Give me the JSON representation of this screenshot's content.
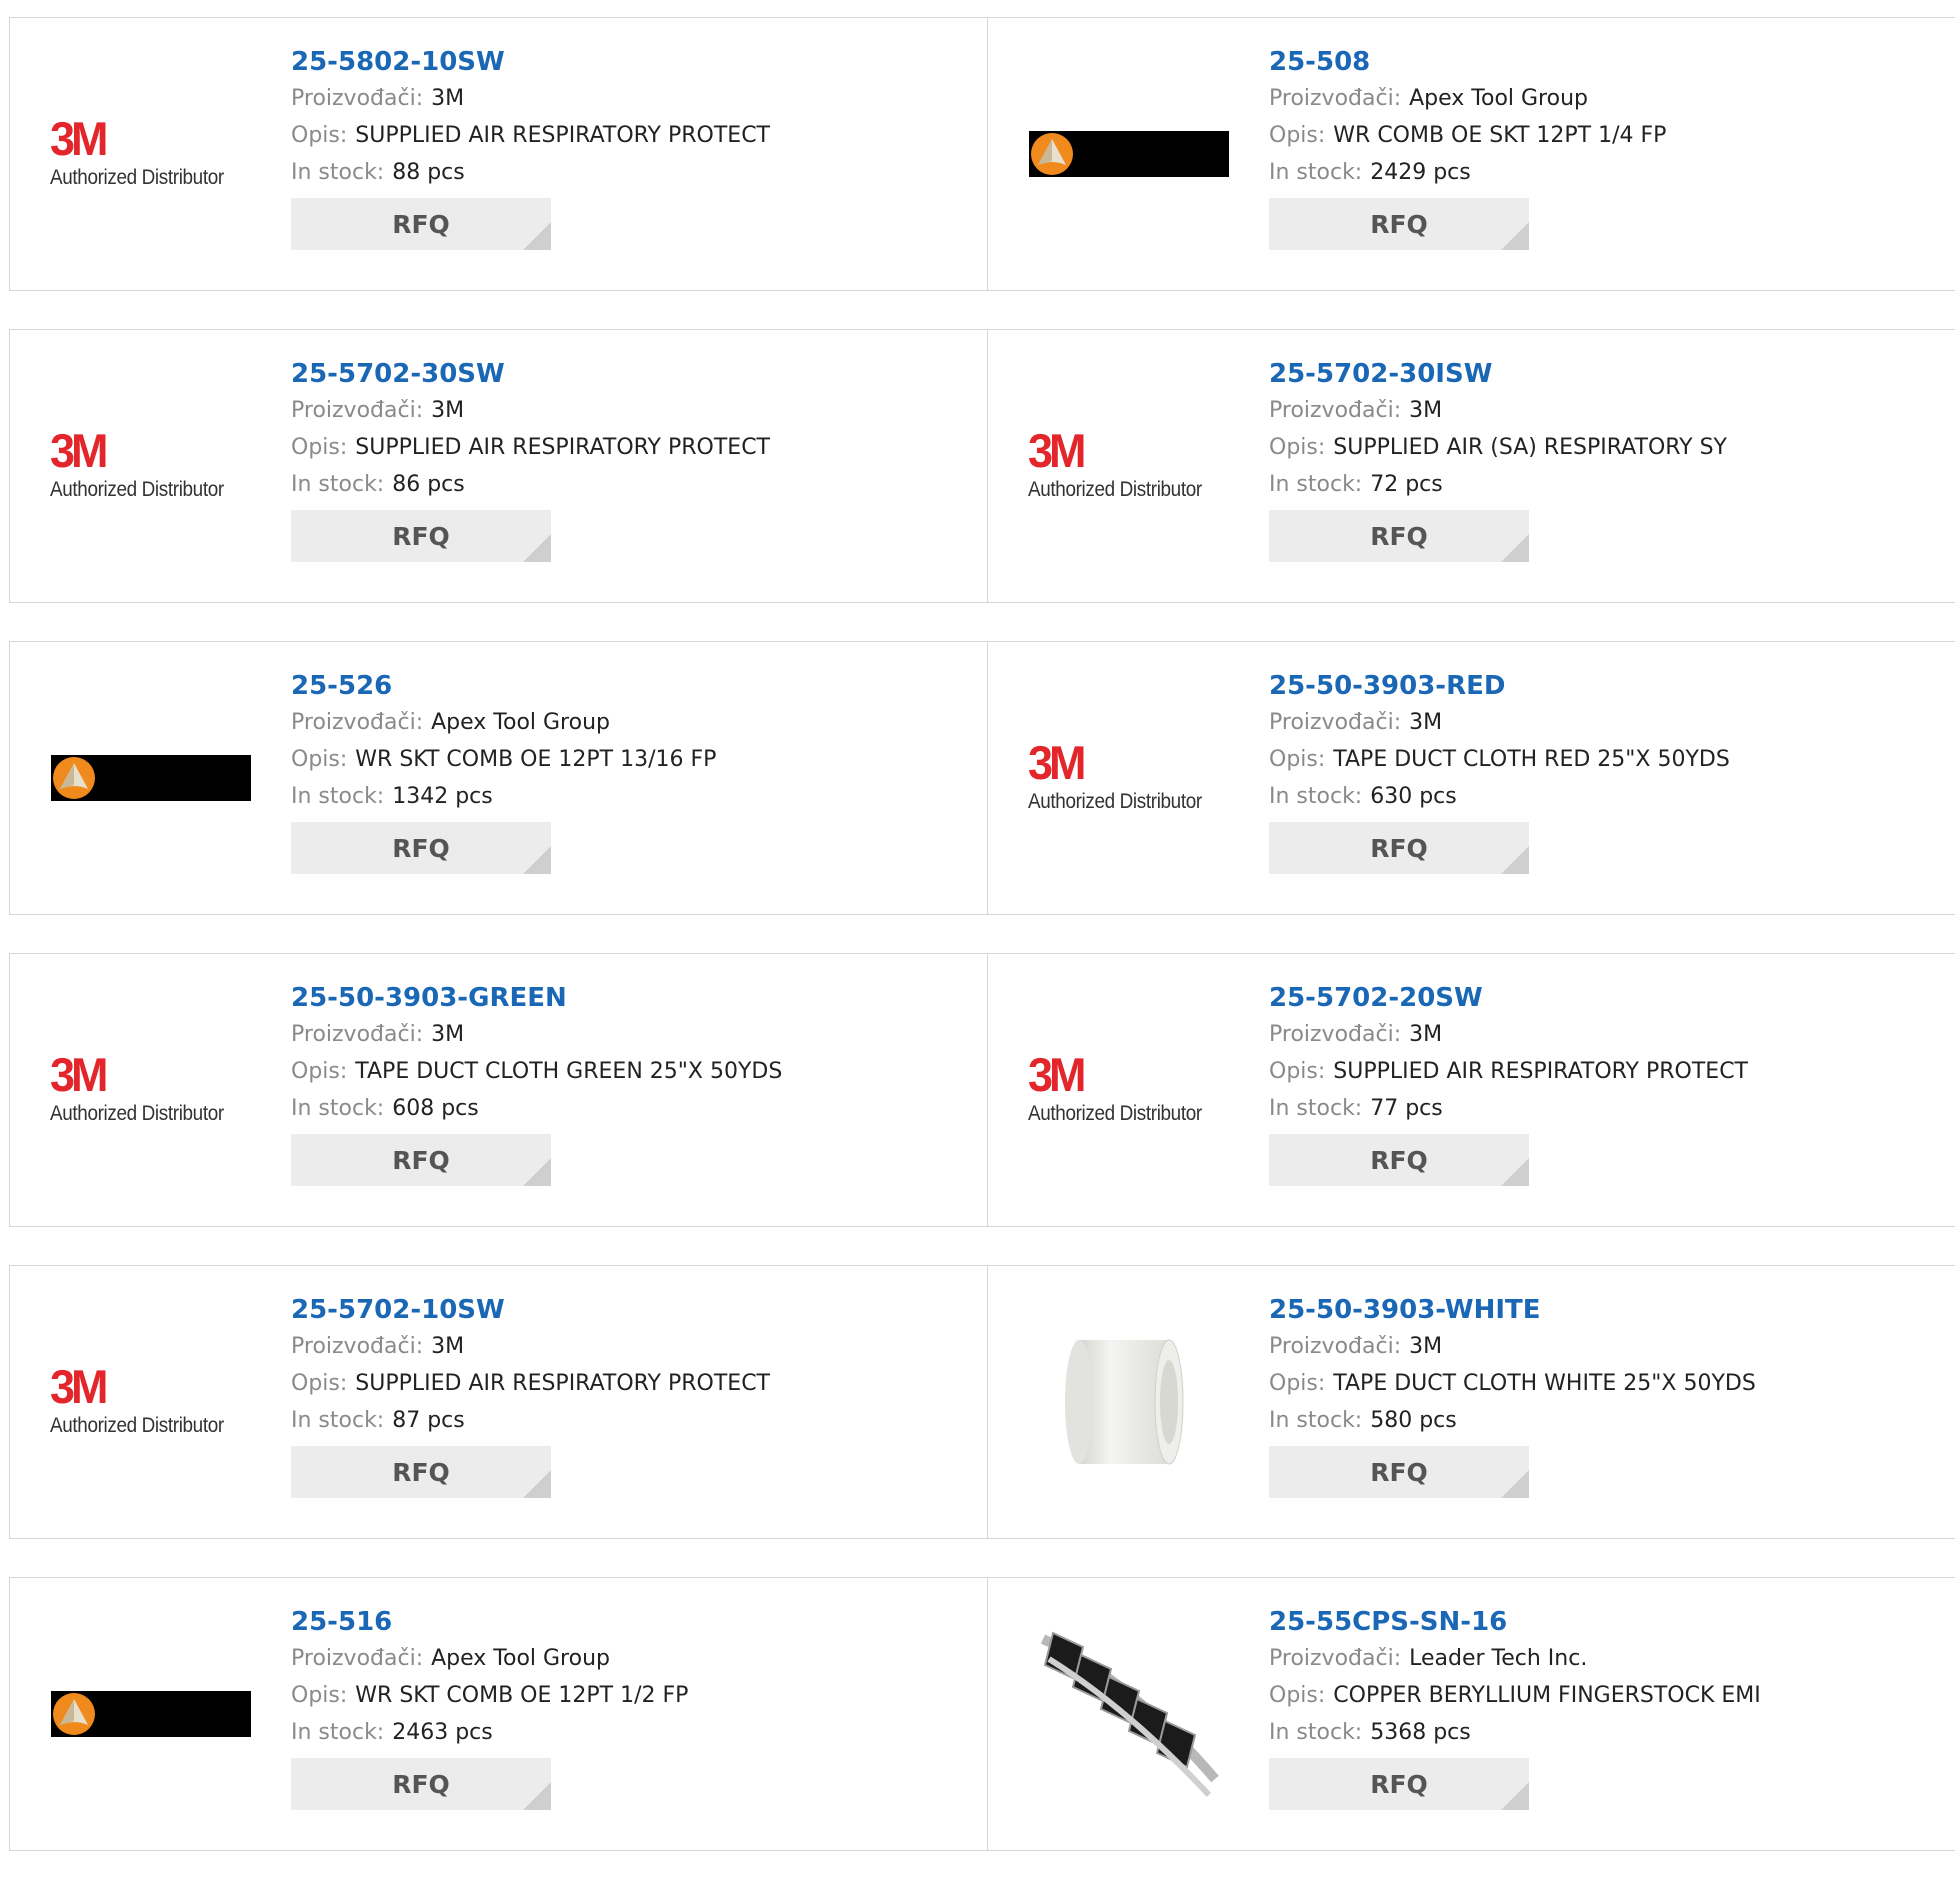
{
  "labels": {
    "manufacturer": "Proizvođači:",
    "description": "Opis:",
    "stock": "In stock:",
    "rfq": "RFQ",
    "authorized": "Authorized Distributor",
    "brand_3m": "3M"
  },
  "colors": {
    "link": "#1a67b6",
    "brand_3m_red": "#e3262b",
    "rfq_bg": "#ececec"
  },
  "products": [
    {
      "part": "25-5802-10SW",
      "manufacturer": "3M",
      "description": "SUPPLIED AIR RESPIRATORY PROTECT",
      "stock": "88 pcs",
      "logo": "3m-logo"
    },
    {
      "part": "25-508",
      "manufacturer": "Apex Tool Group",
      "description": "WR COMB OE SKT 12PT 1/4 FP",
      "stock": "2429 pcs",
      "logo": "apex-logo"
    },
    {
      "part": "25-5702-30SW",
      "manufacturer": "3M",
      "description": "SUPPLIED AIR RESPIRATORY PROTECT",
      "stock": "86 pcs",
      "logo": "3m-logo"
    },
    {
      "part": "25-5702-30ISW",
      "manufacturer": "3M",
      "description": "SUPPLIED AIR (SA) RESPIRATORY SY",
      "stock": "72 pcs",
      "logo": "3m-logo"
    },
    {
      "part": "25-526",
      "manufacturer": "Apex Tool Group",
      "description": "WR SKT COMB OE 12PT 13/16 FP",
      "stock": "1342 pcs",
      "logo": "apex-logo"
    },
    {
      "part": "25-50-3903-RED",
      "manufacturer": "3M",
      "description": "TAPE DUCT CLOTH RED 25\"X 50YDS",
      "stock": "630 pcs",
      "logo": "3m-logo"
    },
    {
      "part": "25-50-3903-GREEN",
      "manufacturer": "3M",
      "description": "TAPE DUCT CLOTH GREEN 25\"X 50YDS",
      "stock": "608 pcs",
      "logo": "3m-logo"
    },
    {
      "part": "25-5702-20SW",
      "manufacturer": "3M",
      "description": "SUPPLIED AIR RESPIRATORY PROTECT",
      "stock": "77 pcs",
      "logo": "3m-logo"
    },
    {
      "part": "25-5702-10SW",
      "manufacturer": "3M",
      "description": "SUPPLIED AIR RESPIRATORY PROTECT",
      "stock": "87 pcs",
      "logo": "3m-logo"
    },
    {
      "part": "25-50-3903-WHITE",
      "manufacturer": "3M",
      "description": "TAPE DUCT CLOTH WHITE 25\"X 50YDS",
      "stock": "580 pcs",
      "logo": "tape-image"
    },
    {
      "part": "25-516",
      "manufacturer": "Apex Tool Group",
      "description": "WR SKT COMB OE 12PT 1/2 FP",
      "stock": "2463 pcs",
      "logo": "apex-logo"
    },
    {
      "part": "25-55CPS-SN-16",
      "manufacturer": "Leader Tech Inc.",
      "description": "COPPER BERYLLIUM FINGERSTOCK EMI",
      "stock": "5368 pcs",
      "logo": "fingerstock-image"
    }
  ]
}
